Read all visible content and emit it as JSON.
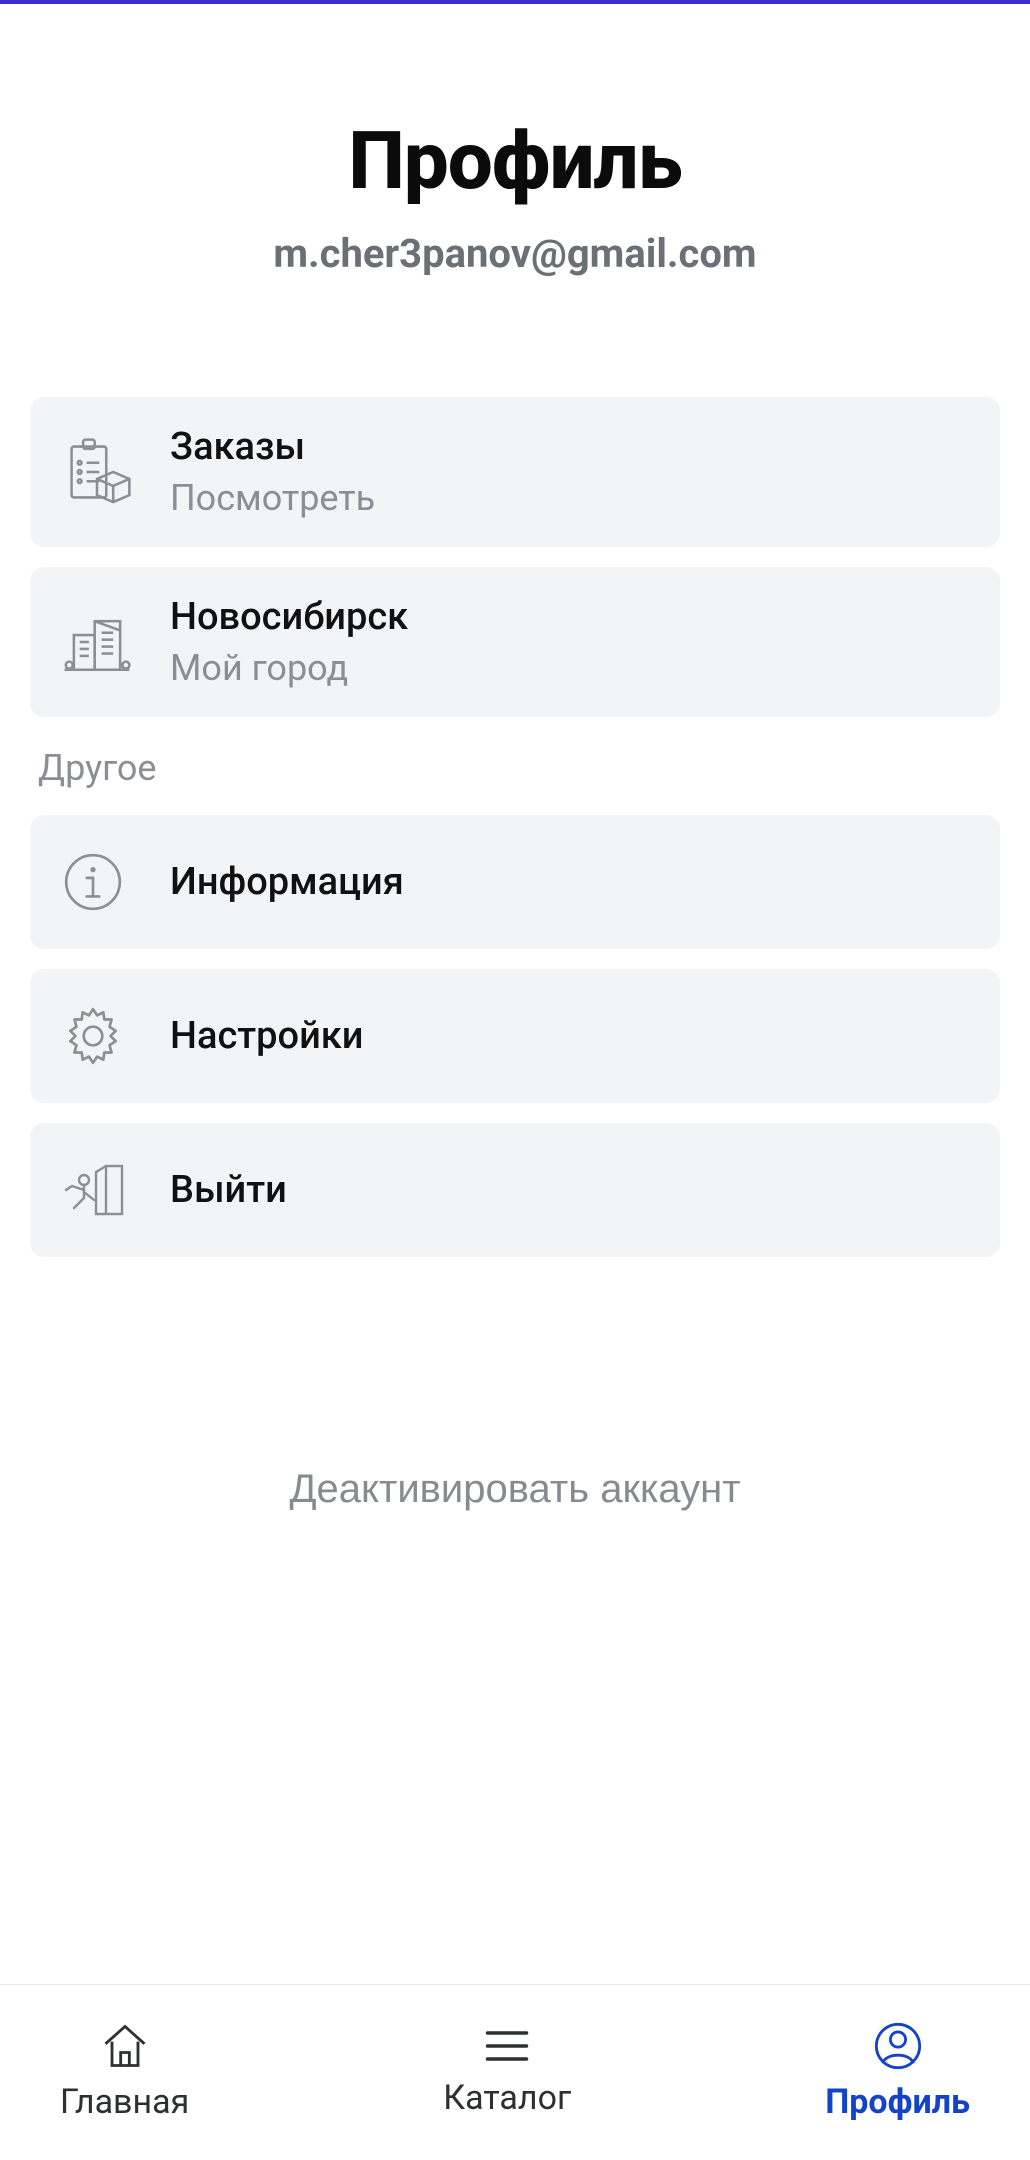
{
  "header": {
    "title": "Профиль",
    "email": "m.cher3panov@gmail.com"
  },
  "menu": {
    "orders": {
      "title": "Заказы",
      "subtitle": "Посмотреть"
    },
    "city": {
      "title": "Новосибирск",
      "subtitle": "Мой город"
    }
  },
  "section_other_label": "Другое",
  "other": {
    "info": {
      "title": "Информация"
    },
    "settings": {
      "title": "Настройки"
    },
    "logout": {
      "title": "Выйти"
    }
  },
  "deactivate_label": "Деактивировать аккаунт",
  "tabs": {
    "home": {
      "label": "Главная"
    },
    "catalog": {
      "label": "Каталог"
    },
    "profile": {
      "label": "Профиль"
    }
  },
  "colors": {
    "accent": "#1442c8",
    "card_bg": "#f3f4f6",
    "muted": "#8a8e95"
  }
}
